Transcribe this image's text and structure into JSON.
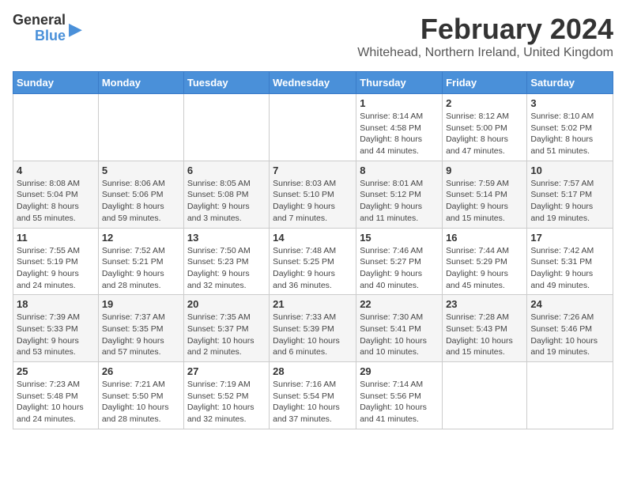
{
  "logo": {
    "line1": "General",
    "line2": "Blue",
    "icon": "▶"
  },
  "title": "February 2024",
  "subtitle": "Whitehead, Northern Ireland, United Kingdom",
  "weekdays": [
    "Sunday",
    "Monday",
    "Tuesday",
    "Wednesday",
    "Thursday",
    "Friday",
    "Saturday"
  ],
  "weeks": [
    [
      {
        "day": "",
        "info": ""
      },
      {
        "day": "",
        "info": ""
      },
      {
        "day": "",
        "info": ""
      },
      {
        "day": "",
        "info": ""
      },
      {
        "day": "1",
        "info": "Sunrise: 8:14 AM\nSunset: 4:58 PM\nDaylight: 8 hours\nand 44 minutes."
      },
      {
        "day": "2",
        "info": "Sunrise: 8:12 AM\nSunset: 5:00 PM\nDaylight: 8 hours\nand 47 minutes."
      },
      {
        "day": "3",
        "info": "Sunrise: 8:10 AM\nSunset: 5:02 PM\nDaylight: 8 hours\nand 51 minutes."
      }
    ],
    [
      {
        "day": "4",
        "info": "Sunrise: 8:08 AM\nSunset: 5:04 PM\nDaylight: 8 hours\nand 55 minutes."
      },
      {
        "day": "5",
        "info": "Sunrise: 8:06 AM\nSunset: 5:06 PM\nDaylight: 8 hours\nand 59 minutes."
      },
      {
        "day": "6",
        "info": "Sunrise: 8:05 AM\nSunset: 5:08 PM\nDaylight: 9 hours\nand 3 minutes."
      },
      {
        "day": "7",
        "info": "Sunrise: 8:03 AM\nSunset: 5:10 PM\nDaylight: 9 hours\nand 7 minutes."
      },
      {
        "day": "8",
        "info": "Sunrise: 8:01 AM\nSunset: 5:12 PM\nDaylight: 9 hours\nand 11 minutes."
      },
      {
        "day": "9",
        "info": "Sunrise: 7:59 AM\nSunset: 5:14 PM\nDaylight: 9 hours\nand 15 minutes."
      },
      {
        "day": "10",
        "info": "Sunrise: 7:57 AM\nSunset: 5:17 PM\nDaylight: 9 hours\nand 19 minutes."
      }
    ],
    [
      {
        "day": "11",
        "info": "Sunrise: 7:55 AM\nSunset: 5:19 PM\nDaylight: 9 hours\nand 24 minutes."
      },
      {
        "day": "12",
        "info": "Sunrise: 7:52 AM\nSunset: 5:21 PM\nDaylight: 9 hours\nand 28 minutes."
      },
      {
        "day": "13",
        "info": "Sunrise: 7:50 AM\nSunset: 5:23 PM\nDaylight: 9 hours\nand 32 minutes."
      },
      {
        "day": "14",
        "info": "Sunrise: 7:48 AM\nSunset: 5:25 PM\nDaylight: 9 hours\nand 36 minutes."
      },
      {
        "day": "15",
        "info": "Sunrise: 7:46 AM\nSunset: 5:27 PM\nDaylight: 9 hours\nand 40 minutes."
      },
      {
        "day": "16",
        "info": "Sunrise: 7:44 AM\nSunset: 5:29 PM\nDaylight: 9 hours\nand 45 minutes."
      },
      {
        "day": "17",
        "info": "Sunrise: 7:42 AM\nSunset: 5:31 PM\nDaylight: 9 hours\nand 49 minutes."
      }
    ],
    [
      {
        "day": "18",
        "info": "Sunrise: 7:39 AM\nSunset: 5:33 PM\nDaylight: 9 hours\nand 53 minutes."
      },
      {
        "day": "19",
        "info": "Sunrise: 7:37 AM\nSunset: 5:35 PM\nDaylight: 9 hours\nand 57 minutes."
      },
      {
        "day": "20",
        "info": "Sunrise: 7:35 AM\nSunset: 5:37 PM\nDaylight: 10 hours\nand 2 minutes."
      },
      {
        "day": "21",
        "info": "Sunrise: 7:33 AM\nSunset: 5:39 PM\nDaylight: 10 hours\nand 6 minutes."
      },
      {
        "day": "22",
        "info": "Sunrise: 7:30 AM\nSunset: 5:41 PM\nDaylight: 10 hours\nand 10 minutes."
      },
      {
        "day": "23",
        "info": "Sunrise: 7:28 AM\nSunset: 5:43 PM\nDaylight: 10 hours\nand 15 minutes."
      },
      {
        "day": "24",
        "info": "Sunrise: 7:26 AM\nSunset: 5:46 PM\nDaylight: 10 hours\nand 19 minutes."
      }
    ],
    [
      {
        "day": "25",
        "info": "Sunrise: 7:23 AM\nSunset: 5:48 PM\nDaylight: 10 hours\nand 24 minutes."
      },
      {
        "day": "26",
        "info": "Sunrise: 7:21 AM\nSunset: 5:50 PM\nDaylight: 10 hours\nand 28 minutes."
      },
      {
        "day": "27",
        "info": "Sunrise: 7:19 AM\nSunset: 5:52 PM\nDaylight: 10 hours\nand 32 minutes."
      },
      {
        "day": "28",
        "info": "Sunrise: 7:16 AM\nSunset: 5:54 PM\nDaylight: 10 hours\nand 37 minutes."
      },
      {
        "day": "29",
        "info": "Sunrise: 7:14 AM\nSunset: 5:56 PM\nDaylight: 10 hours\nand 41 minutes."
      },
      {
        "day": "",
        "info": ""
      },
      {
        "day": "",
        "info": ""
      }
    ]
  ]
}
